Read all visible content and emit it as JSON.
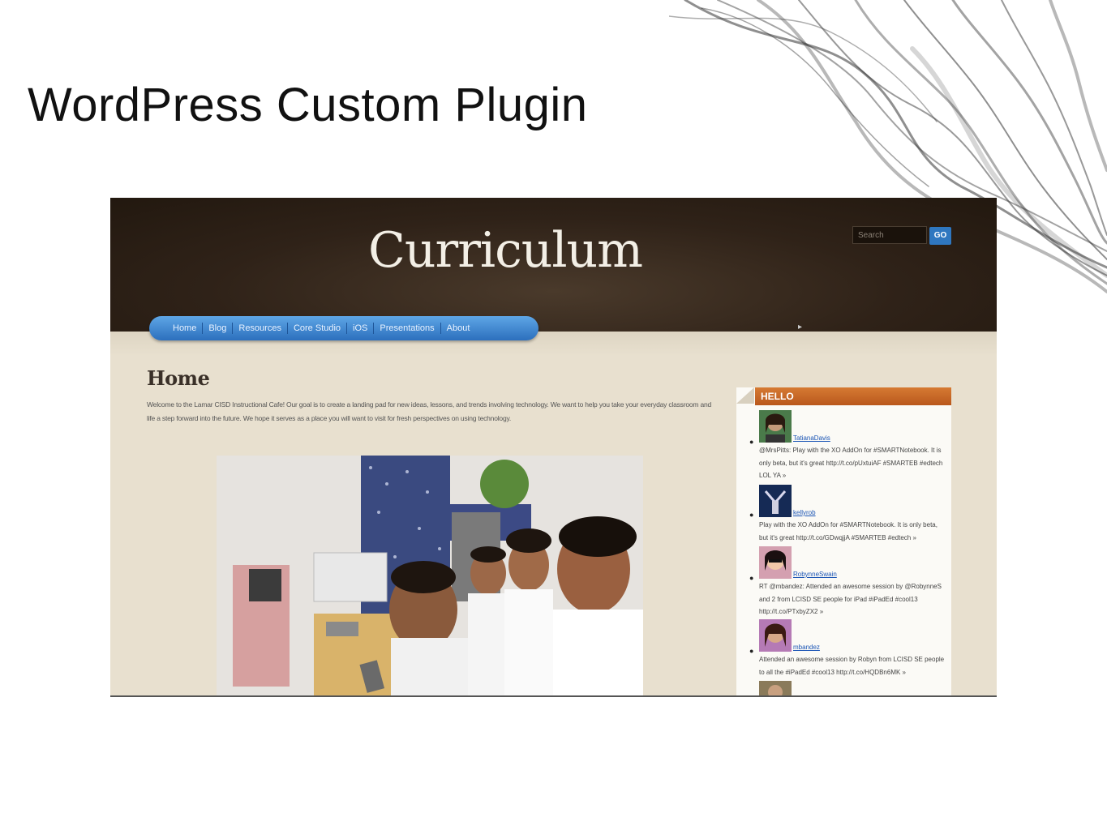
{
  "slide": {
    "title": "WordPress Custom Plugin"
  },
  "site": {
    "logo": "Curriculum",
    "search": {
      "placeholder": "Search",
      "go_label": "GO"
    },
    "nav": [
      {
        "label": "Home"
      },
      {
        "label": "Blog"
      },
      {
        "label": "Resources"
      },
      {
        "label": "Core Studio"
      },
      {
        "label": "iOS"
      },
      {
        "label": "Presentations"
      },
      {
        "label": "About"
      }
    ],
    "page": {
      "heading": "Home",
      "intro": "Welcome to the Lamar CISD Instructional Cafe! Our goal is to create a landing pad for new ideas, lessons, and trends involving technology. We want to help you take your everyday classroom and life a step forward into the future. We hope it serves as a place you will want to visit for fresh perspectives on using technology."
    },
    "sidebar": {
      "widget_title": "HELLO",
      "tweets": [
        {
          "handle": "TatianaDavis",
          "text": "@MrsPitts: Play with the XO AddOn for #SMARTNotebook. It is only beta, but it's great http://t.co/pUxtuiAF #SMARTEB #edtech LOL YA »"
        },
        {
          "handle": "kellyrob",
          "text": "Play with the XO AddOn for #SMARTNotebook. It is only beta, but it's great http://t.co/GDwqjjA #SMARTEB #edtech »"
        },
        {
          "handle": "RobynneSwain",
          "text": "RT @mbandez: Attended an awesome session by @RobynneS and 2 from LCISD SE people for iPad #iPadEd #cool13 http://t.co/PTxbyZX2 »"
        },
        {
          "handle": "mbandez",
          "text": "Attended an awesome session by Robyn from LCISD SE people to all the #iPadEd #cool13 http://t.co/HQDBn6MK »"
        }
      ]
    }
  }
}
